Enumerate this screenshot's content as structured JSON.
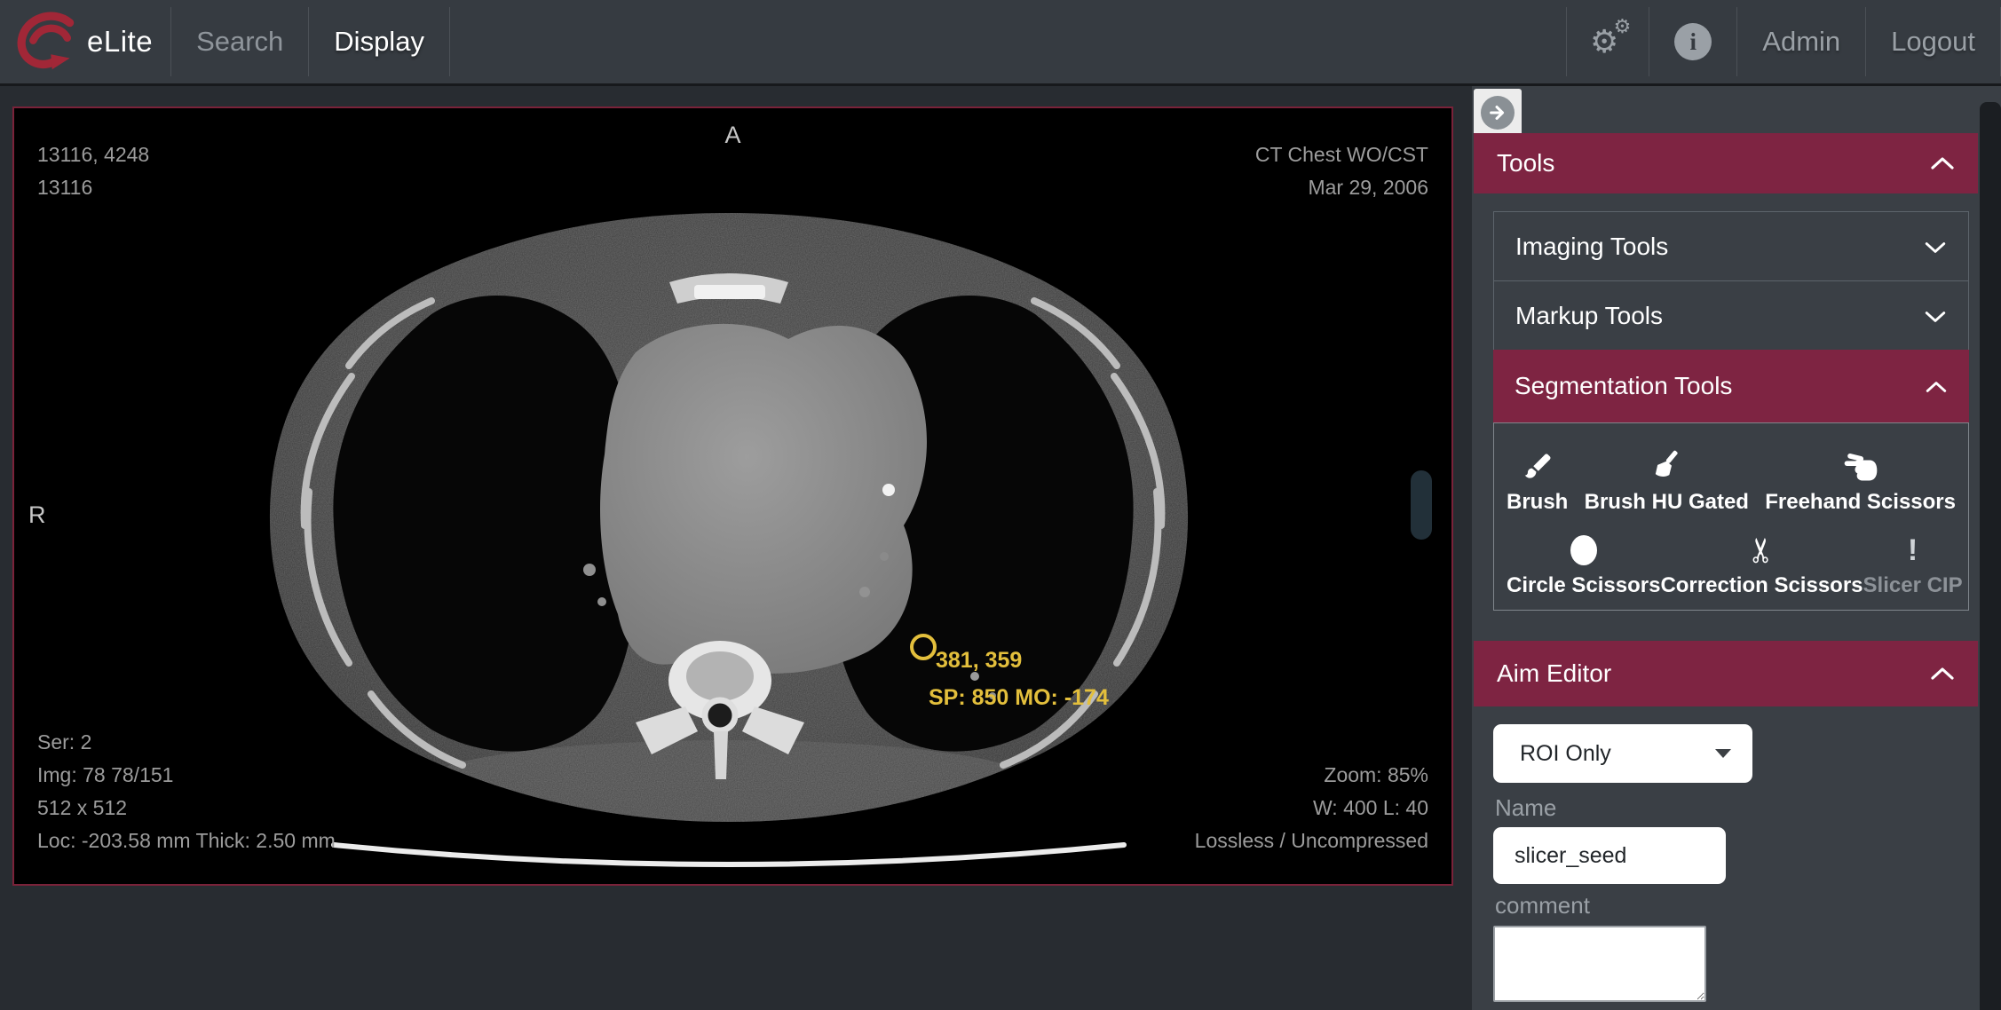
{
  "navbar": {
    "brand": "eLite",
    "tabs": [
      {
        "label": "Search"
      },
      {
        "label": "Display"
      }
    ],
    "gears_glyph": "⚙",
    "info_glyph": "i",
    "links": [
      {
        "label": "Admin"
      },
      {
        "label": "Logout"
      }
    ]
  },
  "viewer": {
    "orientation": {
      "top": "A",
      "left": "R"
    },
    "top_left_lines": {
      "0": "13116, 4248",
      "1": "13116"
    },
    "top_right_lines": {
      "0": "CT Chest WO/CST",
      "1": "Mar 29, 2006"
    },
    "bottom_left_lines": {
      "0": "Ser: 2",
      "1": "Img: 78 78/151",
      "2": "512 x 512",
      "3": "Loc: -203.58 mm Thick: 2.50 mm"
    },
    "bottom_right_lines": {
      "0": "Zoom: 85%",
      "1": "W: 400 L: 40",
      "2": "Lossless / Uncompressed"
    },
    "annotation": {
      "coords": "381, 359",
      "stats": "SP: 850 MO: -174"
    }
  },
  "sidebar": {
    "tools_header": "Tools",
    "accordion": {
      "imaging": "Imaging Tools",
      "markup": "Markup Tools",
      "segmentation": "Segmentation Tools"
    },
    "seg_tools": {
      "brush": "Brush",
      "brush_hu": "Brush HU Gated",
      "freehand": "Freehand Scissors",
      "circle": "Circle Scissors",
      "correction": "Correction Scissors",
      "slicer": "Slicer CIP",
      "correction_glyph": "✂",
      "slicer_glyph": "!"
    },
    "aim_editor": {
      "header": "Aim Editor",
      "template_selected": "ROI Only",
      "name_label": "Name",
      "name_value": "slicer_seed",
      "comment_label": "comment",
      "comment_value": ""
    }
  },
  "colors": {
    "accent_maroon": "#7e2442",
    "viewer_border": "#7a2239",
    "logo_red": "#a12737",
    "annotation_yellow": "#e3bf3c"
  }
}
